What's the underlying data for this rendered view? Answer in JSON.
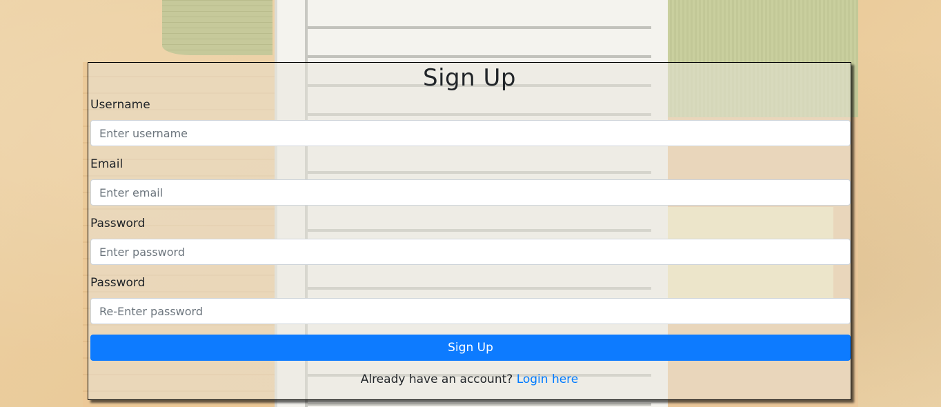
{
  "form": {
    "title": "Sign Up",
    "fields": [
      {
        "label": "Username",
        "placeholder": "Enter username"
      },
      {
        "label": "Email",
        "placeholder": "Enter email"
      },
      {
        "label": "Password",
        "placeholder": "Enter password"
      },
      {
        "label": "Password",
        "placeholder": "Re-Enter password"
      }
    ],
    "submit_label": "Sign Up",
    "footer_text": "Already have an account?",
    "login_link": "Login here"
  },
  "colors": {
    "accent": "#0d7bff",
    "link": "#007bff"
  }
}
